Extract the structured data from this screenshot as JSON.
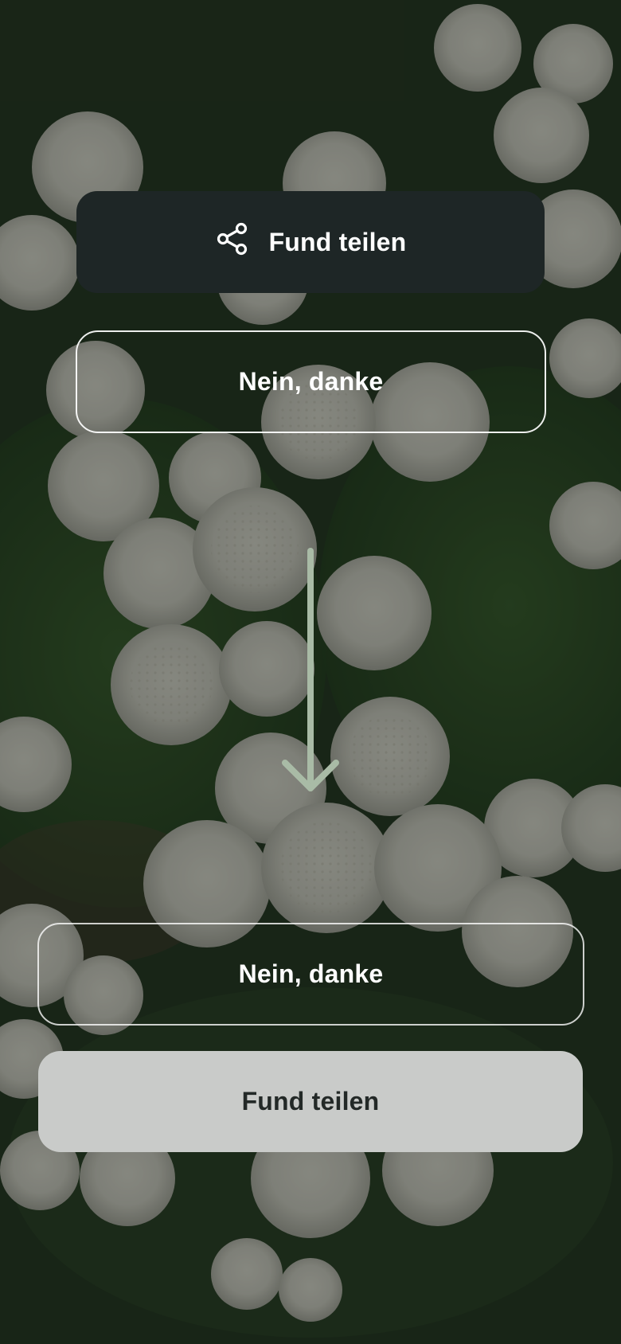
{
  "background": {
    "description_icon": "flower-photo",
    "scrim_color": "#0c120e"
  },
  "share_primary": {
    "label": "Fund teilen",
    "icon": "share-icon",
    "background": "#1e2626"
  },
  "decline_top": {
    "label": "Nein, danke"
  },
  "arrow": {
    "icon": "arrow-down-icon",
    "color": "#a9bba6"
  },
  "decline_bottom": {
    "label": "Nein, danke"
  },
  "share_secondary": {
    "label": "Fund teilen",
    "background": "#c9cbc9"
  }
}
